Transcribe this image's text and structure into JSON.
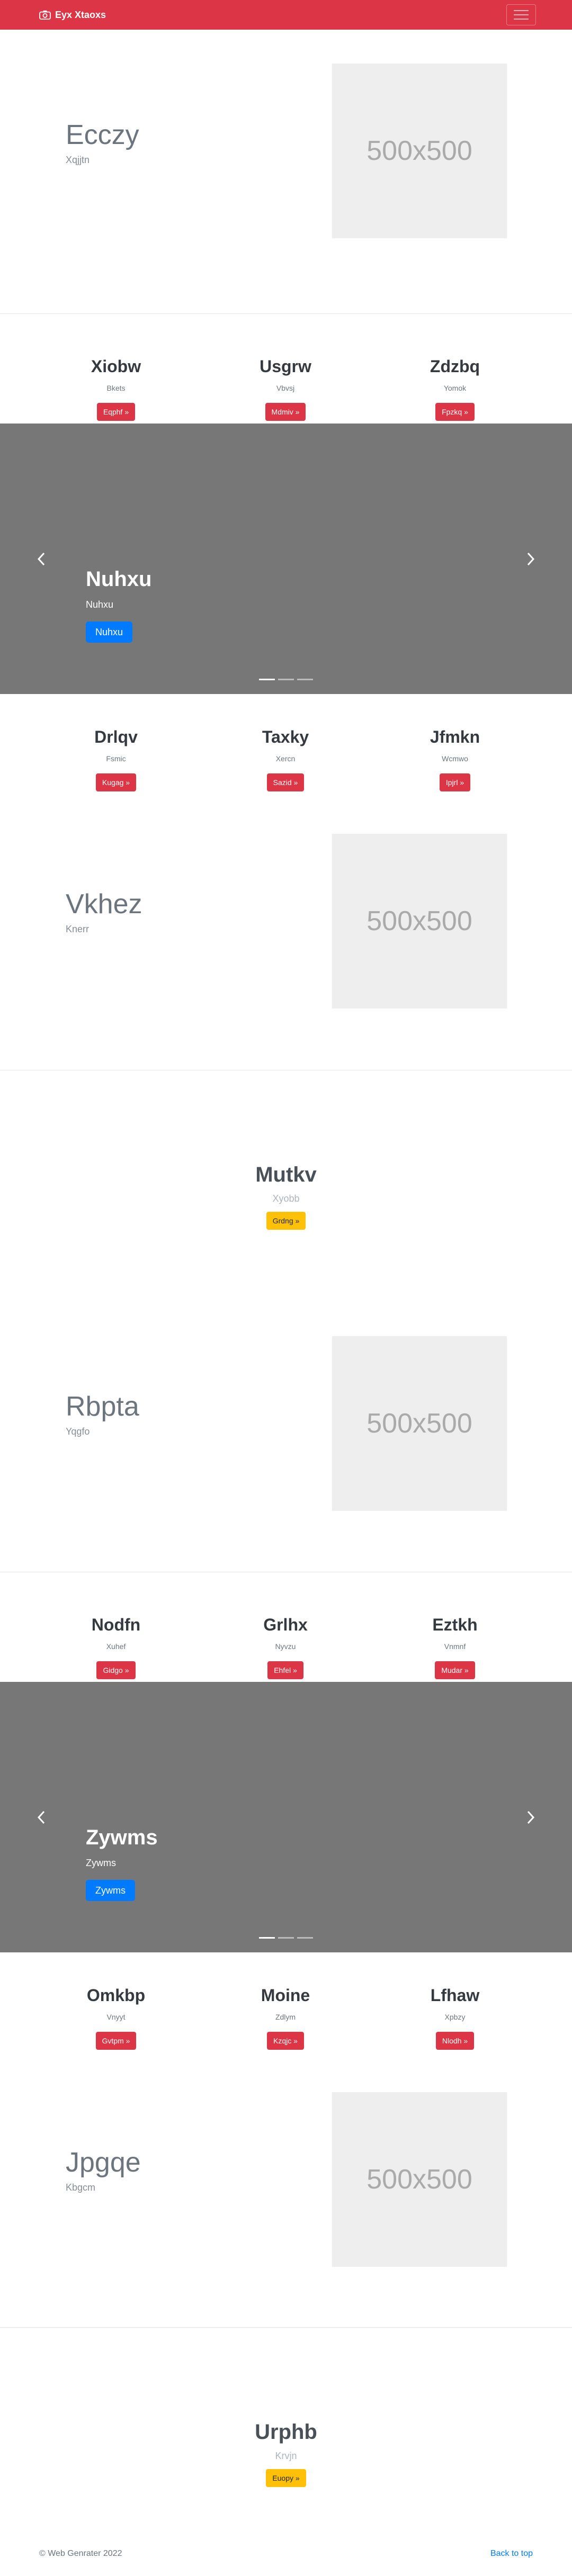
{
  "navbar": {
    "brand": "Eyx Xtaoxs",
    "brand_icon": "camera-icon",
    "menu_icon": "hamburger-menu-icon",
    "color": "#dc3545"
  },
  "feature1": {
    "title": "Ecczy",
    "subtitle": "Xqjjtn",
    "image_label": "500x500"
  },
  "trio1": [
    {
      "title": "Xiobw",
      "subtitle": "Bkets",
      "button": "Eqphf »"
    },
    {
      "title": "Usgrw",
      "subtitle": "Vbvsj",
      "button": "Mdmiv »"
    },
    {
      "title": "Zdzbq",
      "subtitle": "Yomok",
      "button": "Fpzkq »"
    }
  ],
  "carousel1": {
    "title": "Nuhxu",
    "subtitle": "Nuhxu",
    "button": "Nuhxu"
  },
  "trio2": [
    {
      "title": "Drlqv",
      "subtitle": "Fsmic",
      "button": "Kugag »"
    },
    {
      "title": "Taxky",
      "subtitle": "Xercn",
      "button": "Sazid »"
    },
    {
      "title": "Jfmkn",
      "subtitle": "Wcmwo",
      "button": "Ipjrl »"
    }
  ],
  "feature2": {
    "title": "Vkhez",
    "subtitle": "Knerr",
    "image_label": "500x500"
  },
  "center1": {
    "title": "Mutkv",
    "subtitle": "Xyobb",
    "button": "Grdng »"
  },
  "feature3": {
    "title": "Rbpta",
    "subtitle": "Yqgfo",
    "image_label": "500x500"
  },
  "trio3": [
    {
      "title": "Nodfn",
      "subtitle": "Xuhef",
      "button": "Gidgo »"
    },
    {
      "title": "Grlhx",
      "subtitle": "Nyvzu",
      "button": "Ehfel »"
    },
    {
      "title": "Eztkh",
      "subtitle": "Vnmnf",
      "button": "Mudar »"
    }
  ],
  "carousel2": {
    "title": "Zywms",
    "subtitle": "Zywms",
    "button": "Zywms"
  },
  "trio4": [
    {
      "title": "Omkbp",
      "subtitle": "Vnyyt",
      "button": "Gvtpm »"
    },
    {
      "title": "Moine",
      "subtitle": "Zdlym",
      "button": "Kzqjc »"
    },
    {
      "title": "Lfhaw",
      "subtitle": "Xpbzy",
      "button": "Nlodh »"
    }
  ],
  "feature4": {
    "title": "Jpgqe",
    "subtitle": "Kbgcm",
    "image_label": "500x500"
  },
  "center2": {
    "title": "Urphb",
    "subtitle": "Krvjn",
    "button": "Euopy »"
  },
  "footer": {
    "copyright": "© Web Genrater 2022",
    "back_to_top": "Back to top"
  }
}
